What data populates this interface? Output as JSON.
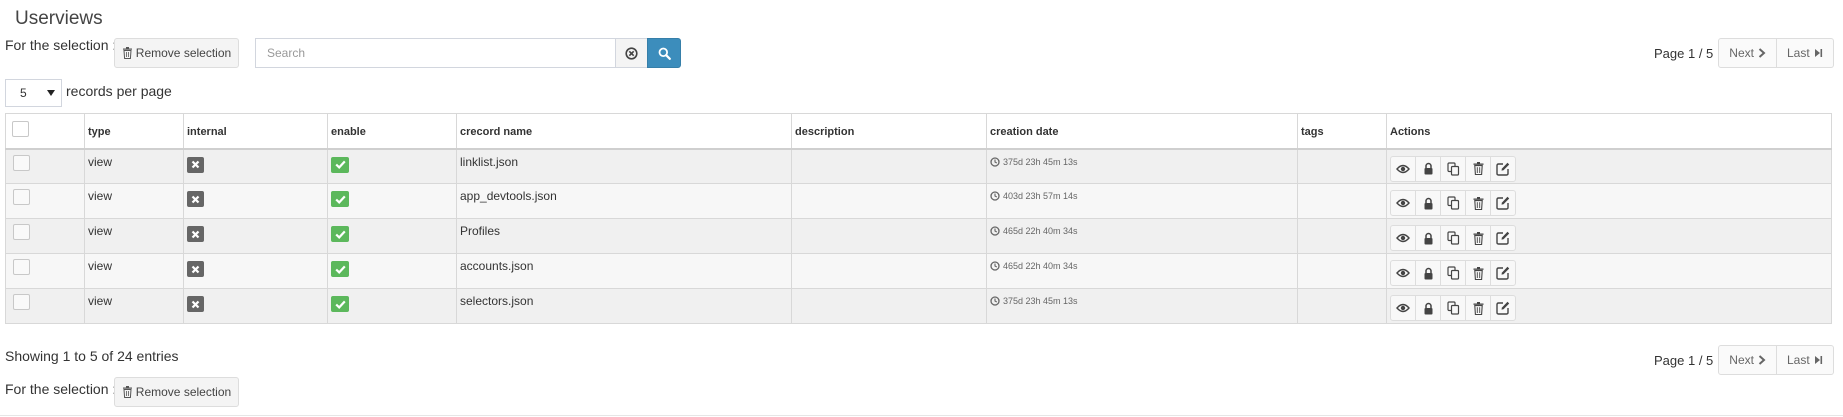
{
  "page": {
    "title": "Userviews"
  },
  "selection": {
    "label": "For the selection :",
    "remove_label": "Remove selection"
  },
  "search": {
    "placeholder": "Search",
    "value": ""
  },
  "pagination": {
    "info": "Page 1 / 5",
    "next_label": "Next",
    "last_label": "Last"
  },
  "records_per_page": {
    "value": "5",
    "label": "records per page"
  },
  "table": {
    "columns": [
      "type",
      "internal",
      "enable",
      "crecord name",
      "description",
      "creation date",
      "tags",
      "Actions"
    ],
    "rows": [
      {
        "type": "view",
        "internal": false,
        "enable": true,
        "name": "linklist.json",
        "description": "",
        "created": "375d 23h 45m 13s",
        "tags": ""
      },
      {
        "type": "view",
        "internal": false,
        "enable": true,
        "name": "app_devtools.json",
        "description": "",
        "created": "403d 23h 57m 14s",
        "tags": ""
      },
      {
        "type": "view",
        "internal": false,
        "enable": true,
        "name": "Profiles",
        "description": "",
        "created": "465d 22h 40m 34s",
        "tags": ""
      },
      {
        "type": "view",
        "internal": false,
        "enable": true,
        "name": "accounts.json",
        "description": "",
        "created": "465d 22h 40m 34s",
        "tags": ""
      },
      {
        "type": "view",
        "internal": false,
        "enable": true,
        "name": "selectors.json",
        "description": "",
        "created": "375d 23h 45m 13s",
        "tags": ""
      }
    ],
    "row_actions": [
      "eye-icon",
      "lock-icon",
      "duplicate-icon",
      "trash-icon",
      "edit-icon"
    ]
  },
  "footer": {
    "showing": "Showing 1 to 5 of 24 entries"
  },
  "colors": {
    "primary": "#3c8dbc",
    "success": "#5cb85c",
    "muted_badge": "#666666",
    "row_bg": "#f0f0f0"
  }
}
